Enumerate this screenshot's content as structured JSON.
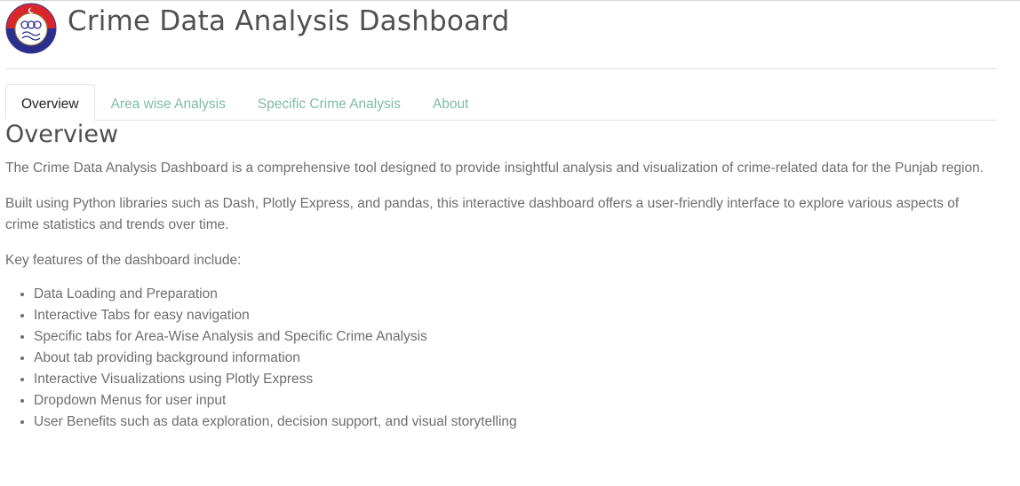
{
  "header": {
    "title": "Crime Data Analysis Dashboard",
    "logo_icon": "punjab-police-logo"
  },
  "tabs": [
    {
      "label": "Overview",
      "active": true
    },
    {
      "label": "Area wise Analysis",
      "active": false
    },
    {
      "label": "Specific Crime Analysis",
      "active": false
    },
    {
      "label": "About",
      "active": false
    }
  ],
  "overview": {
    "heading": "Overview",
    "paragraphs": [
      "The Crime Data Analysis Dashboard is a comprehensive tool designed to provide insightful analysis and visualization of crime-related data for the Punjab region.",
      "Built using Python libraries such as Dash, Plotly Express, and pandas, this interactive dashboard offers a user-friendly interface to explore various aspects of crime statistics and trends over time.",
      "Key features of the dashboard include:"
    ],
    "features": [
      "Data Loading and Preparation",
      "Interactive Tabs for easy navigation",
      "Specific tabs for Area-Wise Analysis and Specific Crime Analysis",
      "About tab providing background information",
      "Interactive Visualizations using Plotly Express",
      "Dropdown Menus for user input",
      "User Benefits such as data exploration, decision support, and visual storytelling"
    ]
  },
  "colors": {
    "tab_inactive": "#7fbca4",
    "tab_active": "#222222",
    "heading": "#505050",
    "body_text": "#6e6e6e",
    "logo_red": "#d9262c",
    "logo_blue": "#2a2e8c"
  }
}
